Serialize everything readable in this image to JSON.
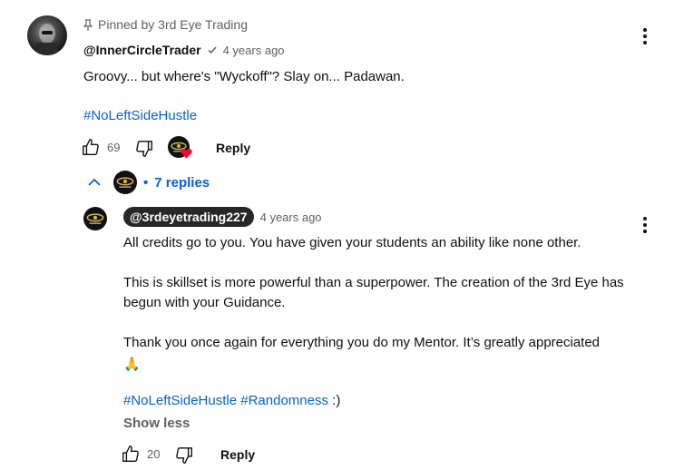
{
  "comment": {
    "pinned_label": "Pinned by 3rd Eye Trading",
    "author": "@InnerCircleTrader",
    "time": "4 years ago",
    "text": "Groovy... but where's \"Wyckoff\"?  Slay on... Padawan.",
    "hashtag": "#NoLeftSideHustle",
    "like_count": "69",
    "reply_label": "Reply",
    "replies_label": "7 replies"
  },
  "reply": {
    "author": "@3rdeyetrading227",
    "time": "4 years ago",
    "line1": "All credits go to you. You have given your students an ability like none other.",
    "line2": "This is skillset is more powerful than a superpower. The creation of the 3rd Eye has begun with your Guidance.",
    "line3": "Thank you once again for everything you do my Mentor. It’s greatly appreciated",
    "emoji": "🙏",
    "hashtag1": "#NoLeftSideHustle",
    "hashtag2": "#Randomness",
    "hashtag_suffix": " :)",
    "show_less_label": "Show less",
    "like_count": "20",
    "reply_label": "Reply"
  },
  "colors": {
    "link": "#065fd4",
    "muted": "#606060",
    "chip": "#272727",
    "heart": "#ff0033"
  },
  "icons": [
    "pin-icon",
    "verified-check-icon",
    "like-icon",
    "dislike-icon",
    "creator-heart-icon",
    "chevron-up-icon",
    "more-vert-icon"
  ]
}
